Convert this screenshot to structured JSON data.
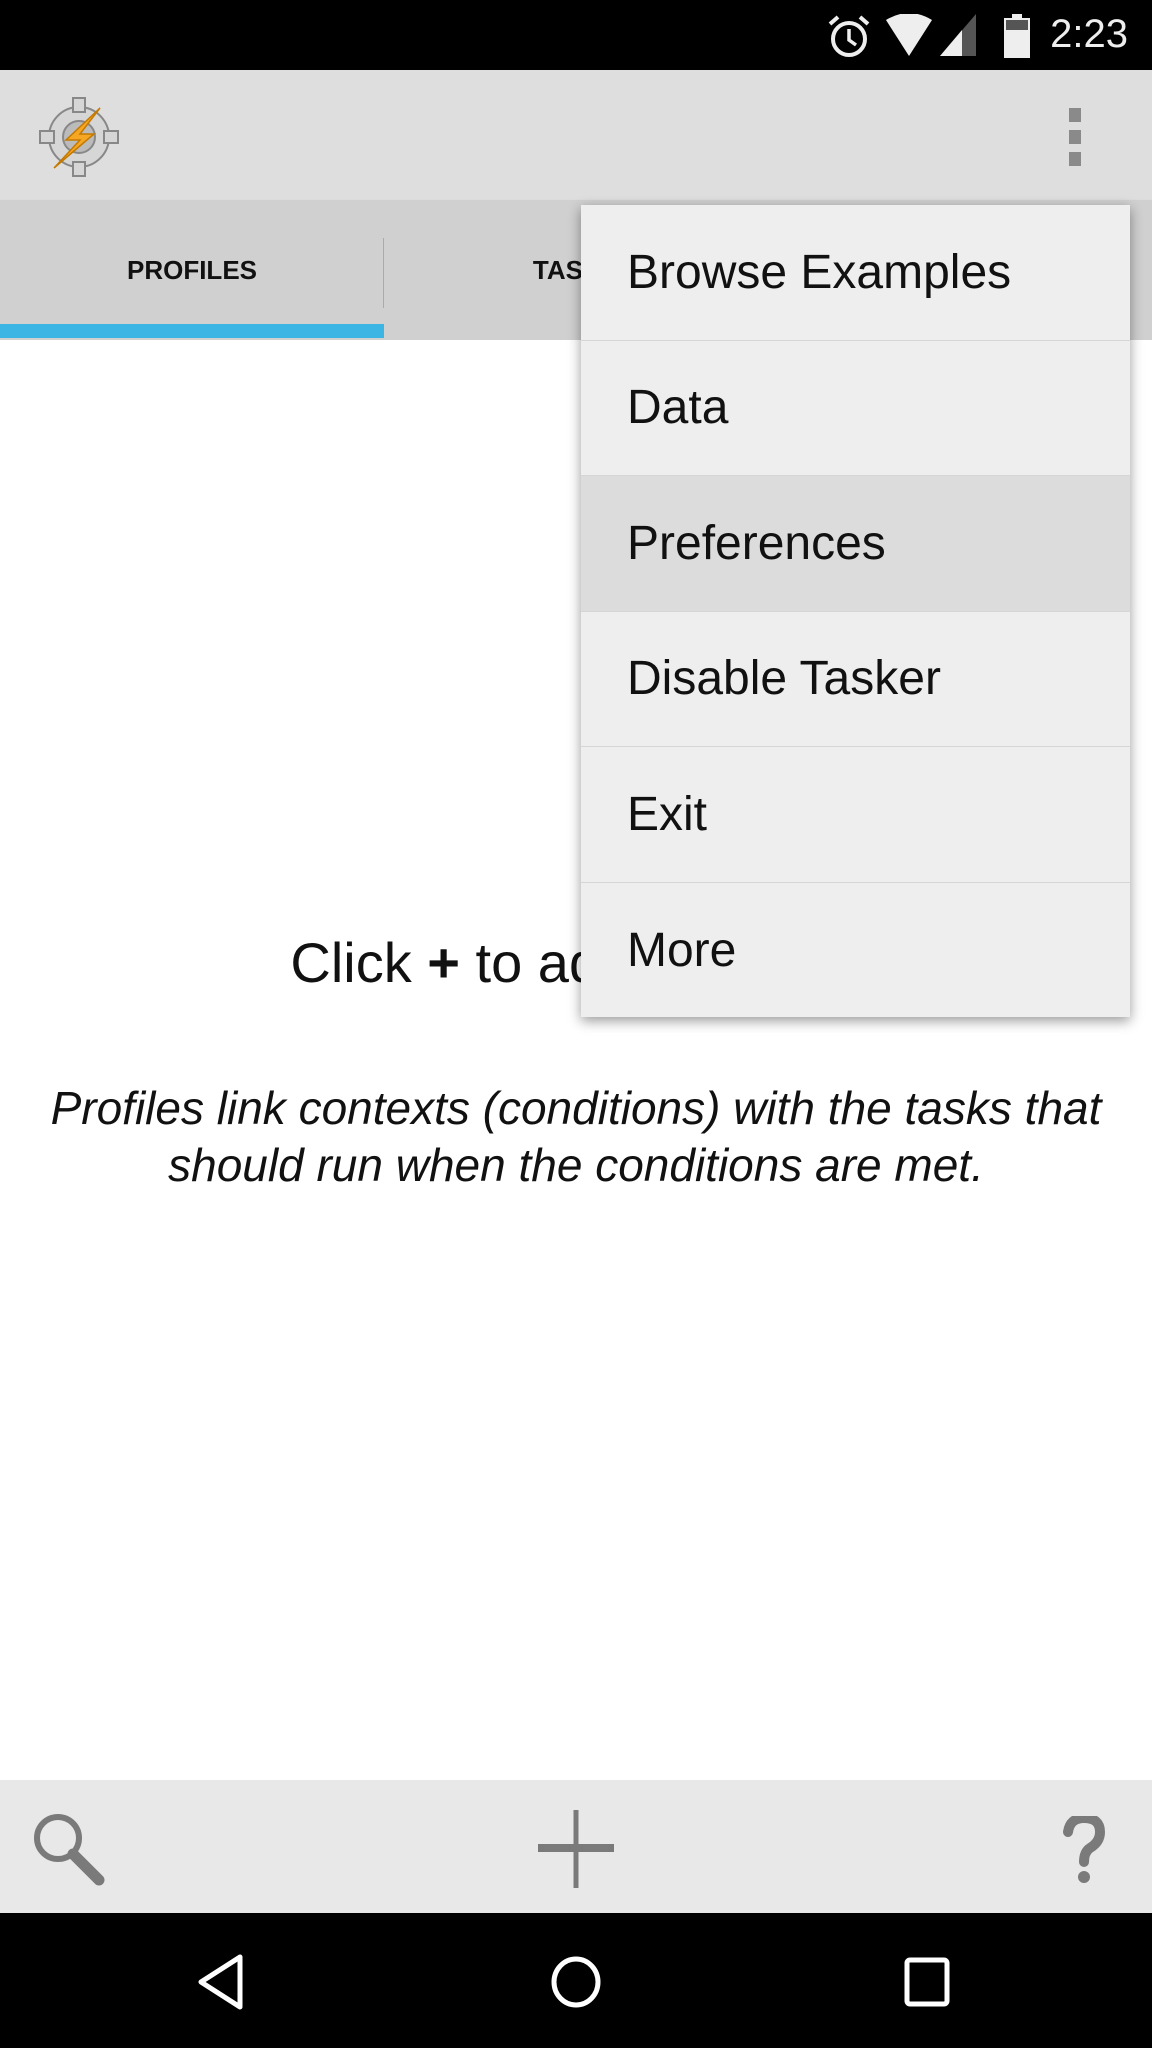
{
  "status_bar": {
    "time": "2:23",
    "battery": "72",
    "icons": [
      "alarm-icon",
      "wifi-icon",
      "signal-icon",
      "battery-icon"
    ]
  },
  "app_bar": {
    "logo": "tasker-logo",
    "overflow_icon": "more-vert-icon"
  },
  "tabs": [
    {
      "label": "PROFILES",
      "selected": true
    },
    {
      "label": "TASKS",
      "selected": false
    }
  ],
  "accent_color": "#3bb5e3",
  "content": {
    "hint_prefix": "Click ",
    "hint_plus": "+",
    "hint_suffix": " to add a profile.",
    "description": "Profiles link contexts (conditions) with the tasks that should run when the conditions are met."
  },
  "menu": {
    "items": [
      {
        "label": "Browse Examples"
      },
      {
        "label": "Data"
      },
      {
        "label": "Preferences",
        "highlighted": true
      },
      {
        "label": "Disable Tasker"
      },
      {
        "label": "Exit"
      },
      {
        "label": "More"
      }
    ]
  },
  "bottom_bar": {
    "icons": [
      "search-icon",
      "add-icon",
      "help-icon"
    ]
  },
  "nav_bar": {
    "icons": [
      "back-icon",
      "home-icon",
      "recents-icon"
    ]
  }
}
